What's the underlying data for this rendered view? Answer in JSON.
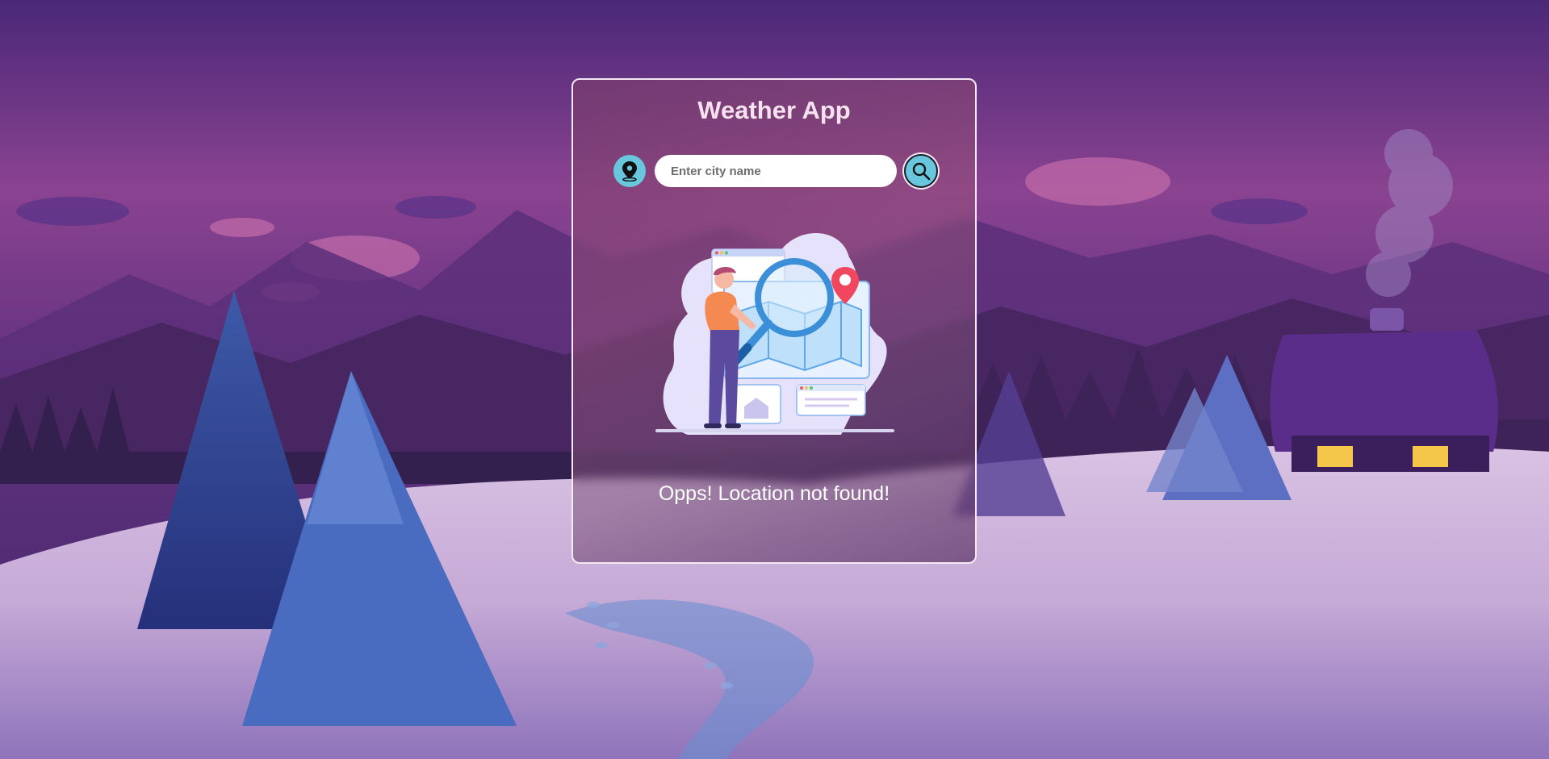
{
  "app": {
    "title": "Weather App"
  },
  "search": {
    "placeholder": "Enter city name",
    "value": ""
  },
  "status": {
    "message": "Opps! Location not found!"
  },
  "icons": {
    "location": "location-pin-icon",
    "search": "magnifier-icon",
    "illustration": "not-found-illustration"
  },
  "colors": {
    "accent": "#69c7dd",
    "title": "#f6e2ee",
    "card_border": "#f2e9f5",
    "message": "#ffffff"
  }
}
